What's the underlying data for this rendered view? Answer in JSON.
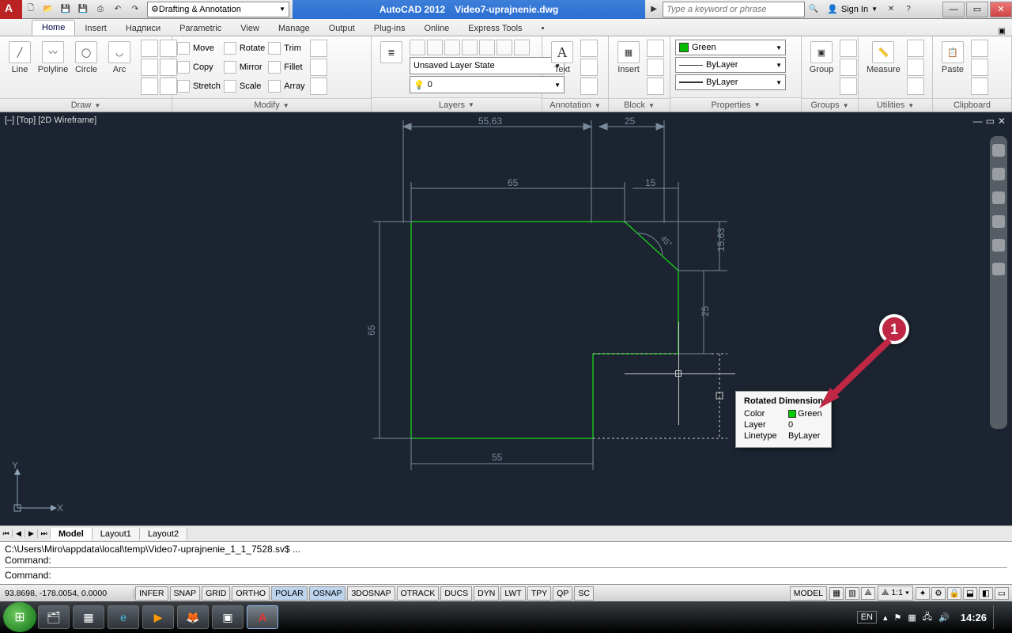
{
  "app": {
    "name": "AutoCAD 2012",
    "file": "Video7-uprajnenie.dwg"
  },
  "qat": {
    "workspace": "Drafting & Annotation",
    "search_placeholder": "Type a keyword or phrase",
    "signin": "Sign In"
  },
  "tabs": [
    "Home",
    "Insert",
    "Надписи",
    "Parametric",
    "View",
    "Manage",
    "Output",
    "Plug-ins",
    "Online",
    "Express Tools"
  ],
  "active_tab": "Home",
  "panels": {
    "draw": {
      "title": "Draw",
      "items": [
        "Line",
        "Polyline",
        "Circle",
        "Arc"
      ]
    },
    "modify": {
      "title": "Modify",
      "rows": [
        [
          "Move",
          "Rotate",
          "Trim"
        ],
        [
          "Copy",
          "Mirror",
          "Fillet"
        ],
        [
          "Stretch",
          "Scale",
          "Array"
        ]
      ]
    },
    "layers": {
      "title": "Layers",
      "state": "Unsaved Layer State"
    },
    "annotation": {
      "title": "Annotation",
      "item": "Text"
    },
    "block": {
      "title": "Block",
      "item": "Insert"
    },
    "properties": {
      "title": "Properties",
      "color": "Green",
      "ltype": "ByLayer",
      "lweight": "ByLayer"
    },
    "groups": {
      "title": "Groups",
      "item": "Group"
    },
    "utilities": {
      "title": "Utilities",
      "item": "Measure"
    },
    "clipboard": {
      "title": "Clipboard",
      "item": "Paste"
    }
  },
  "viewport_label": "[–] [Top] [2D Wireframe]",
  "layout_tabs": [
    "Model",
    "Layout1",
    "Layout2"
  ],
  "active_layout": "Model",
  "cmd": {
    "line1": "C:\\Users\\Miro\\appdata\\local\\temp\\Video7-uprajnenie_1_1_7528.sv$ ...",
    "line2": "Command:",
    "line3": "Command:"
  },
  "status": {
    "coords": "93.8698, -178.0054, 0.0000",
    "toggles": [
      "INFER",
      "SNAP",
      "GRID",
      "ORTHO",
      "POLAR",
      "OSNAP",
      "3DOSNAP",
      "OTRACK",
      "DUCS",
      "DYN",
      "LWT",
      "TPY",
      "QP",
      "SC"
    ],
    "toggles_on": [
      "POLAR",
      "OSNAP"
    ],
    "model_btn": "MODEL",
    "scale": "1:1"
  },
  "tooltip": {
    "title": "Rotated Dimension",
    "color_label": "Color",
    "color_value": "Green",
    "layer_label": "Layer",
    "layer_value": "0",
    "ltype_label": "Linetype",
    "ltype_value": "ByLayer"
  },
  "callout": {
    "num": "1"
  },
  "dims": {
    "d1": "55,63",
    "d2": "25",
    "d3": "65",
    "d4": "15",
    "d5": "15,63",
    "d6": "25",
    "d7": "65",
    "d8": "55",
    "angle": "45°"
  },
  "taskbar": {
    "lang": "EN",
    "time": "14:26"
  }
}
